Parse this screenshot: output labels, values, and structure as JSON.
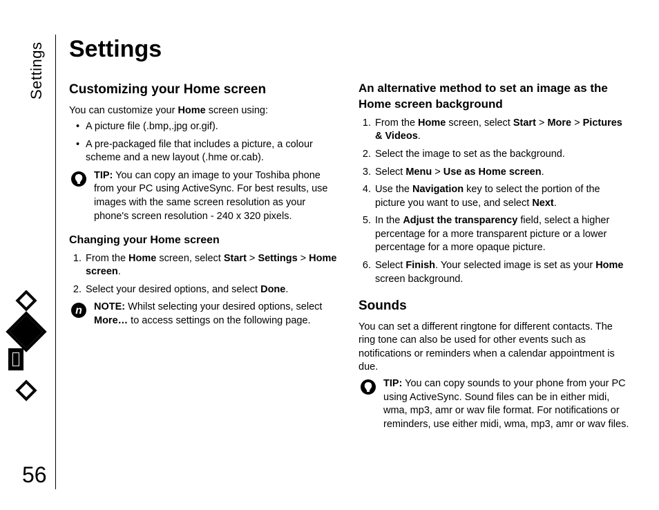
{
  "side_label": "Settings",
  "page_number": "56",
  "title": "Settings",
  "col1": {
    "h2_customizing": "Customizing your Home screen",
    "intro_before": "You can customize your ",
    "intro_bold": "Home",
    "intro_after": " screen using:",
    "bullet1": "A picture file (.bmp,.jpg or.gif).",
    "bullet2": "A pre-packaged file that includes a picture, a colour scheme and a new layout (.hme or.cab).",
    "tip_label": "TIP:",
    "tip_text": " You can copy an image to your Toshiba phone from your PC using ActiveSync. For best results, use images with the same screen resolution as your phone's screen resolution - 240 x 320 pixels.",
    "h3_changing": "Changing your Home screen",
    "step1_a": "From the ",
    "step1_b": "Home",
    "step1_c": " screen, select ",
    "step1_d": "Start",
    "step1_e": " > ",
    "step1_f": "Settings",
    "step1_g": " > ",
    "step1_h": "Home screen",
    "step1_i": ".",
    "step2_a": "Select your desired options, and select ",
    "step2_b": "Done",
    "step2_c": ".",
    "note_label": "NOTE:",
    "note_text_a": " Whilst selecting your desired options, select ",
    "note_text_b": "More…",
    "note_text_c": " to access settings on the following page."
  },
  "col2": {
    "h3_alt": "An alternative method to set an image as the Home screen background",
    "s1a": "From the ",
    "s1b": "Home",
    "s1c": " screen, select ",
    "s1d": "Start",
    "s1e": " > ",
    "s1f": "More",
    "s1g": " > ",
    "s1h": "Pictures & Videos",
    "s1i": ".",
    "s2": "Select the image to set as the background.",
    "s3a": "Select ",
    "s3b": "Menu",
    "s3c": " > ",
    "s3d": "Use as Home screen",
    "s3e": ".",
    "s4a": "Use the ",
    "s4b": "Navigation",
    "s4c": " key to select the portion of the picture you want to use, and select ",
    "s4d": "Next",
    "s4e": ".",
    "s5a": "In the ",
    "s5b": "Adjust the transparency",
    "s5c": " field, select a higher percentage for a more transparent picture or a lower percentage for a more opaque picture.",
    "s6a": "Select ",
    "s6b": "Finish",
    "s6c": ". Your selected image is set as your ",
    "s6d": "Home",
    "s6e": " screen background.",
    "h2_sounds": "Sounds",
    "sounds_p": "You can set a different ringtone for different contacts. The ring tone can also be used for other events such as notifications or reminders when a calendar appointment is due.",
    "tip_label": "TIP:",
    "tip_text": " You can copy sounds to your phone from your PC using ActiveSync. Sound files can be in either midi, wma, mp3, amr or wav file format. For notifications or reminders, use either midi, wma, mp3, amr or wav files."
  }
}
